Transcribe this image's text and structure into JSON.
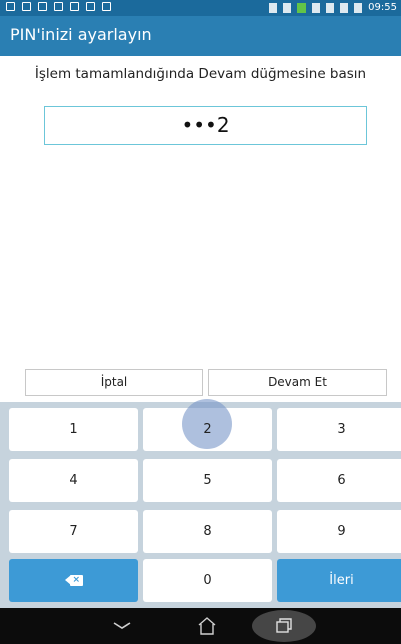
{
  "status_bar": {
    "time": "09:55"
  },
  "header": {
    "title": "PIN'inizi ayarlayın"
  },
  "instruction": "İşlem tamamlandığında Devam düğmesine basın",
  "pin_field": {
    "value": "•••2"
  },
  "buttons": {
    "cancel_label": "İptal",
    "continue_label": "Devam Et"
  },
  "keypad": {
    "k1": "1",
    "k2": "2",
    "k3": "3",
    "k4": "4",
    "k5": "5",
    "k6": "6",
    "k7": "7",
    "k8": "8",
    "k9": "9",
    "k0": "0",
    "next_label": "İleri",
    "pressed_key": "2"
  },
  "colors": {
    "title_bar": "#2a7fb3",
    "status_bar": "#1b6a9c",
    "keyboard_bg": "#c6d3dd",
    "accent_key": "#3d9ad6",
    "pin_border": "#6cc6d9"
  },
  "icons": {
    "backspace": "backspace-icon",
    "back": "back-icon",
    "home": "home-icon",
    "recent_apps": "recent-apps-icon"
  }
}
